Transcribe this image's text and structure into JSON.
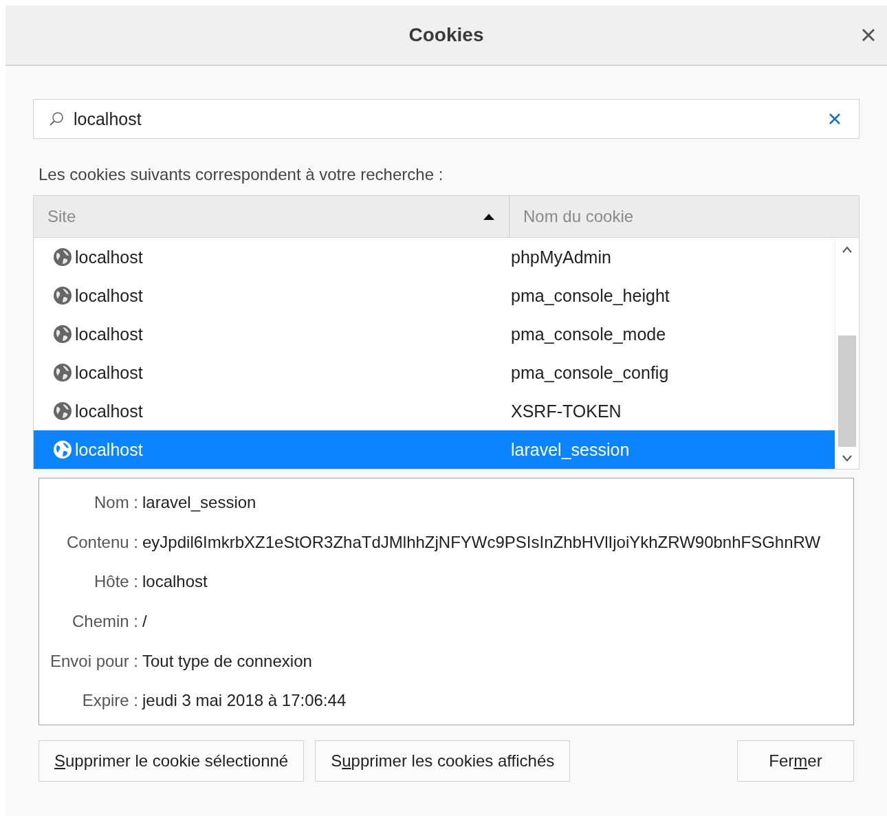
{
  "window": {
    "title": "Cookies"
  },
  "search": {
    "value": "localhost"
  },
  "results_label": "Les cookies suivants correspondent à votre recherche :",
  "table": {
    "columns": [
      {
        "label": "Site",
        "sorted": true
      },
      {
        "label": "Nom du cookie",
        "sorted": false
      }
    ],
    "rows": [
      {
        "site": "localhost",
        "name": "phpMyAdmin",
        "selected": false
      },
      {
        "site": "localhost",
        "name": "pma_console_height",
        "selected": false
      },
      {
        "site": "localhost",
        "name": "pma_console_mode",
        "selected": false
      },
      {
        "site": "localhost",
        "name": "pma_console_config",
        "selected": false
      },
      {
        "site": "localhost",
        "name": "XSRF-TOKEN",
        "selected": false
      },
      {
        "site": "localhost",
        "name": "laravel_session",
        "selected": true
      }
    ]
  },
  "details": [
    {
      "label": "Nom :",
      "value": "laravel_session"
    },
    {
      "label": "Contenu :",
      "value": "eyJpdil6ImkrbXZ1eStOR3ZhaTdJMlhhZjNFYWc9PSIsInZhbHVlIjoiYkhZRW90bnhFSGhnRW"
    },
    {
      "label": "Hôte :",
      "value": "localhost"
    },
    {
      "label": "Chemin :",
      "value": "/"
    },
    {
      "label": "Envoi pour :",
      "value": "Tout type de connexion"
    },
    {
      "label": "Expire :",
      "value": "jeudi 3 mai 2018 à 17:06:44"
    }
  ],
  "buttons": [
    {
      "key": "S",
      "post": "upprimer le cookie sélectionné"
    },
    {
      "pre": "S",
      "key": "u",
      "post": "pprimer les cookies affichés"
    },
    {
      "pre": "Fer",
      "key": "m",
      "post": "er"
    }
  ]
}
